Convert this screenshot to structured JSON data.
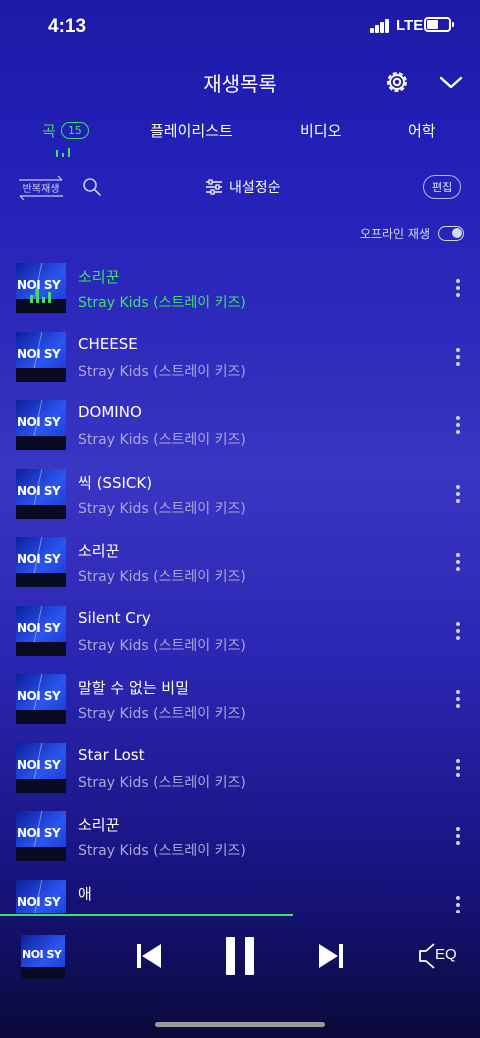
{
  "status_bar": {
    "time": "4:13",
    "network": "LTE"
  },
  "header": {
    "title": "재생목록",
    "settings_icon": "gear-icon",
    "collapse_icon": "chevron-down-icon"
  },
  "tabs": {
    "song": {
      "label": "곡",
      "count": "15"
    },
    "playlist": {
      "label": "플레이리스트"
    },
    "video": {
      "label": "비디오"
    },
    "language": {
      "label": "어학"
    }
  },
  "toolbar": {
    "repeat_label": "반복재생",
    "sort_label": "내설정순",
    "edit_label": "편집"
  },
  "offline": {
    "label": "오프라인 재생"
  },
  "colors": {
    "accent": "#3ee06a",
    "background": "#2320b8"
  },
  "songs": [
    {
      "title": "소리꾼",
      "artist": "Stray Kids (스트레이 키즈)",
      "cover_text": "NOI SY"
    },
    {
      "title": "CHEESE",
      "artist": "Stray Kids (스트레이 키즈)",
      "cover_text": "NOI SY"
    },
    {
      "title": "DOMINO",
      "artist": "Stray Kids (스트레이 키즈)",
      "cover_text": "NOI SY"
    },
    {
      "title": "씩 (SSICK)",
      "artist": "Stray Kids (스트레이 키즈)",
      "cover_text": "NOI SY"
    },
    {
      "title": "소리꾼",
      "artist": "Stray Kids (스트레이 키즈)",
      "cover_text": "NOI SY"
    },
    {
      "title": "Silent Cry",
      "artist": "Stray Kids (스트레이 키즈)",
      "cover_text": "NOI SY"
    },
    {
      "title": "말할 수 없는 비밀",
      "artist": "Stray Kids (스트레이 키즈)",
      "cover_text": "NOI SY"
    },
    {
      "title": "Star Lost",
      "artist": "Stray Kids (스트레이 키즈)",
      "cover_text": "NOI SY"
    },
    {
      "title": "소리꾼",
      "artist": "Stray Kids (스트레이 키즈)",
      "cover_text": "NOI SY"
    },
    {
      "title": "애",
      "artist": "",
      "cover_text": "NOI SY"
    }
  ],
  "player": {
    "cover_text": "NOI SY",
    "eq_label": "EQ",
    "progress_fraction": 0.61
  }
}
